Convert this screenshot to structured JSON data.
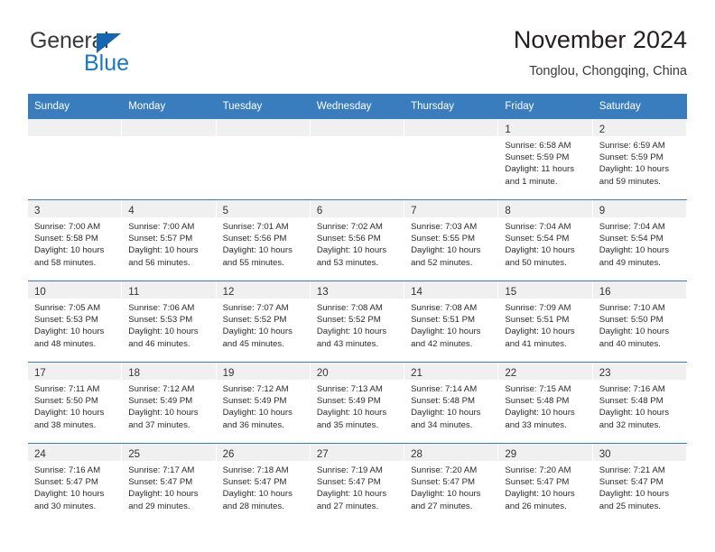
{
  "brand": {
    "name_part1": "General",
    "name_part2": "Blue",
    "triangle_color": "#1565b5",
    "blue_color": "#1976c8"
  },
  "header": {
    "title": "November 2024",
    "subtitle": "Tonglou, Chongqing, China",
    "header_bg_color": "#3a7dbf",
    "daynum_band_color": "#f0f0f0"
  },
  "weekday_headers": [
    "Sunday",
    "Monday",
    "Tuesday",
    "Wednesday",
    "Thursday",
    "Friday",
    "Saturday"
  ],
  "weeks": [
    [
      {
        "day": "",
        "sunrise": "",
        "sunset": "",
        "daylight1": "",
        "daylight2": ""
      },
      {
        "day": "",
        "sunrise": "",
        "sunset": "",
        "daylight1": "",
        "daylight2": ""
      },
      {
        "day": "",
        "sunrise": "",
        "sunset": "",
        "daylight1": "",
        "daylight2": ""
      },
      {
        "day": "",
        "sunrise": "",
        "sunset": "",
        "daylight1": "",
        "daylight2": ""
      },
      {
        "day": "",
        "sunrise": "",
        "sunset": "",
        "daylight1": "",
        "daylight2": ""
      },
      {
        "day": "1",
        "sunrise": "Sunrise: 6:58 AM",
        "sunset": "Sunset: 5:59 PM",
        "daylight1": "Daylight: 11 hours",
        "daylight2": "and 1 minute."
      },
      {
        "day": "2",
        "sunrise": "Sunrise: 6:59 AM",
        "sunset": "Sunset: 5:59 PM",
        "daylight1": "Daylight: 10 hours",
        "daylight2": "and 59 minutes."
      }
    ],
    [
      {
        "day": "3",
        "sunrise": "Sunrise: 7:00 AM",
        "sunset": "Sunset: 5:58 PM",
        "daylight1": "Daylight: 10 hours",
        "daylight2": "and 58 minutes."
      },
      {
        "day": "4",
        "sunrise": "Sunrise: 7:00 AM",
        "sunset": "Sunset: 5:57 PM",
        "daylight1": "Daylight: 10 hours",
        "daylight2": "and 56 minutes."
      },
      {
        "day": "5",
        "sunrise": "Sunrise: 7:01 AM",
        "sunset": "Sunset: 5:56 PM",
        "daylight1": "Daylight: 10 hours",
        "daylight2": "and 55 minutes."
      },
      {
        "day": "6",
        "sunrise": "Sunrise: 7:02 AM",
        "sunset": "Sunset: 5:56 PM",
        "daylight1": "Daylight: 10 hours",
        "daylight2": "and 53 minutes."
      },
      {
        "day": "7",
        "sunrise": "Sunrise: 7:03 AM",
        "sunset": "Sunset: 5:55 PM",
        "daylight1": "Daylight: 10 hours",
        "daylight2": "and 52 minutes."
      },
      {
        "day": "8",
        "sunrise": "Sunrise: 7:04 AM",
        "sunset": "Sunset: 5:54 PM",
        "daylight1": "Daylight: 10 hours",
        "daylight2": "and 50 minutes."
      },
      {
        "day": "9",
        "sunrise": "Sunrise: 7:04 AM",
        "sunset": "Sunset: 5:54 PM",
        "daylight1": "Daylight: 10 hours",
        "daylight2": "and 49 minutes."
      }
    ],
    [
      {
        "day": "10",
        "sunrise": "Sunrise: 7:05 AM",
        "sunset": "Sunset: 5:53 PM",
        "daylight1": "Daylight: 10 hours",
        "daylight2": "and 48 minutes."
      },
      {
        "day": "11",
        "sunrise": "Sunrise: 7:06 AM",
        "sunset": "Sunset: 5:53 PM",
        "daylight1": "Daylight: 10 hours",
        "daylight2": "and 46 minutes."
      },
      {
        "day": "12",
        "sunrise": "Sunrise: 7:07 AM",
        "sunset": "Sunset: 5:52 PM",
        "daylight1": "Daylight: 10 hours",
        "daylight2": "and 45 minutes."
      },
      {
        "day": "13",
        "sunrise": "Sunrise: 7:08 AM",
        "sunset": "Sunset: 5:52 PM",
        "daylight1": "Daylight: 10 hours",
        "daylight2": "and 43 minutes."
      },
      {
        "day": "14",
        "sunrise": "Sunrise: 7:08 AM",
        "sunset": "Sunset: 5:51 PM",
        "daylight1": "Daylight: 10 hours",
        "daylight2": "and 42 minutes."
      },
      {
        "day": "15",
        "sunrise": "Sunrise: 7:09 AM",
        "sunset": "Sunset: 5:51 PM",
        "daylight1": "Daylight: 10 hours",
        "daylight2": "and 41 minutes."
      },
      {
        "day": "16",
        "sunrise": "Sunrise: 7:10 AM",
        "sunset": "Sunset: 5:50 PM",
        "daylight1": "Daylight: 10 hours",
        "daylight2": "and 40 minutes."
      }
    ],
    [
      {
        "day": "17",
        "sunrise": "Sunrise: 7:11 AM",
        "sunset": "Sunset: 5:50 PM",
        "daylight1": "Daylight: 10 hours",
        "daylight2": "and 38 minutes."
      },
      {
        "day": "18",
        "sunrise": "Sunrise: 7:12 AM",
        "sunset": "Sunset: 5:49 PM",
        "daylight1": "Daylight: 10 hours",
        "daylight2": "and 37 minutes."
      },
      {
        "day": "19",
        "sunrise": "Sunrise: 7:12 AM",
        "sunset": "Sunset: 5:49 PM",
        "daylight1": "Daylight: 10 hours",
        "daylight2": "and 36 minutes."
      },
      {
        "day": "20",
        "sunrise": "Sunrise: 7:13 AM",
        "sunset": "Sunset: 5:49 PM",
        "daylight1": "Daylight: 10 hours",
        "daylight2": "and 35 minutes."
      },
      {
        "day": "21",
        "sunrise": "Sunrise: 7:14 AM",
        "sunset": "Sunset: 5:48 PM",
        "daylight1": "Daylight: 10 hours",
        "daylight2": "and 34 minutes."
      },
      {
        "day": "22",
        "sunrise": "Sunrise: 7:15 AM",
        "sunset": "Sunset: 5:48 PM",
        "daylight1": "Daylight: 10 hours",
        "daylight2": "and 33 minutes."
      },
      {
        "day": "23",
        "sunrise": "Sunrise: 7:16 AM",
        "sunset": "Sunset: 5:48 PM",
        "daylight1": "Daylight: 10 hours",
        "daylight2": "and 32 minutes."
      }
    ],
    [
      {
        "day": "24",
        "sunrise": "Sunrise: 7:16 AM",
        "sunset": "Sunset: 5:47 PM",
        "daylight1": "Daylight: 10 hours",
        "daylight2": "and 30 minutes."
      },
      {
        "day": "25",
        "sunrise": "Sunrise: 7:17 AM",
        "sunset": "Sunset: 5:47 PM",
        "daylight1": "Daylight: 10 hours",
        "daylight2": "and 29 minutes."
      },
      {
        "day": "26",
        "sunrise": "Sunrise: 7:18 AM",
        "sunset": "Sunset: 5:47 PM",
        "daylight1": "Daylight: 10 hours",
        "daylight2": "and 28 minutes."
      },
      {
        "day": "27",
        "sunrise": "Sunrise: 7:19 AM",
        "sunset": "Sunset: 5:47 PM",
        "daylight1": "Daylight: 10 hours",
        "daylight2": "and 27 minutes."
      },
      {
        "day": "28",
        "sunrise": "Sunrise: 7:20 AM",
        "sunset": "Sunset: 5:47 PM",
        "daylight1": "Daylight: 10 hours",
        "daylight2": "and 27 minutes."
      },
      {
        "day": "29",
        "sunrise": "Sunrise: 7:20 AM",
        "sunset": "Sunset: 5:47 PM",
        "daylight1": "Daylight: 10 hours",
        "daylight2": "and 26 minutes."
      },
      {
        "day": "30",
        "sunrise": "Sunrise: 7:21 AM",
        "sunset": "Sunset: 5:47 PM",
        "daylight1": "Daylight: 10 hours",
        "daylight2": "and 25 minutes."
      }
    ]
  ]
}
